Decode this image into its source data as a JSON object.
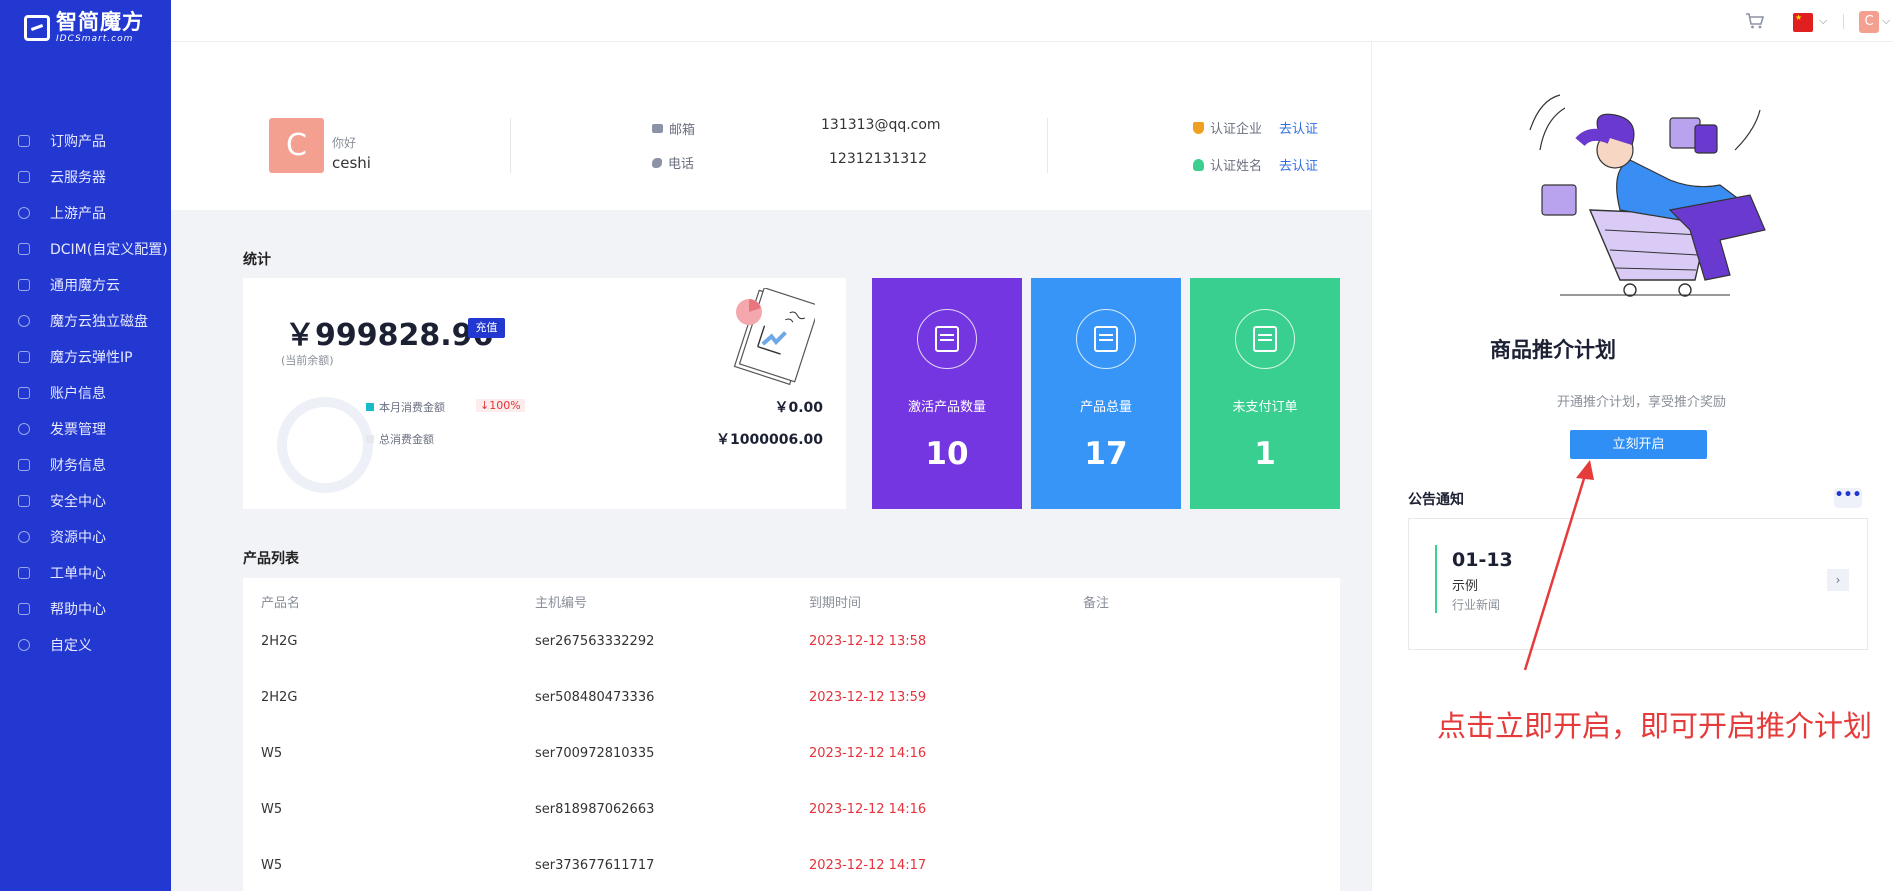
{
  "brand": {
    "name": "智简魔方",
    "sub": "IDCSmart.com"
  },
  "sidebar": {
    "items": [
      {
        "label": "订购产品",
        "icon": "cart-icon"
      },
      {
        "label": "云服务器",
        "icon": "cloud-server-icon"
      },
      {
        "label": "上游产品",
        "icon": "clock-icon"
      },
      {
        "label": "DCIM(自定义配置)",
        "icon": "server-rack-icon"
      },
      {
        "label": "通用魔方云",
        "icon": "cloud-icon"
      },
      {
        "label": "魔方云独立磁盘",
        "icon": "disk-icon"
      },
      {
        "label": "魔方云弹性IP",
        "icon": "ip-icon"
      },
      {
        "label": "账户信息",
        "icon": "user-card-icon"
      },
      {
        "label": "发票管理",
        "icon": "invoice-icon"
      },
      {
        "label": "财务信息",
        "icon": "finance-icon"
      },
      {
        "label": "安全中心",
        "icon": "lock-icon"
      },
      {
        "label": "资源中心",
        "icon": "tag-icon"
      },
      {
        "label": "工单中心",
        "icon": "box-icon"
      },
      {
        "label": "帮助中心",
        "icon": "help-icon"
      },
      {
        "label": "自定义",
        "icon": "info-icon"
      }
    ]
  },
  "topbar": {
    "avatar_letter": "C",
    "language_flag": "china-flag-icon"
  },
  "profile": {
    "avatar_letter": "C",
    "hello": "你好",
    "username": "ceshi",
    "email_label": "邮箱",
    "email_value": "131313@qq.com",
    "phone_label": "电话",
    "phone_value": "12312131312",
    "cert_company_label": "认证企业",
    "cert_company_action": "去认证",
    "cert_name_label": "认证姓名",
    "cert_name_action": "去认证"
  },
  "stats": {
    "title": "统计",
    "balance": "￥999828.96",
    "recharge_label": "充值",
    "balance_sub": "(当前余额)",
    "month_label": "本月消费金额",
    "month_change": "↓100%",
    "month_value": "￥0.00",
    "total_label": "总消费金额",
    "total_value": "￥1000006.00",
    "tiles": [
      {
        "label": "激活产品数量",
        "value": "10",
        "color": "#7436e0"
      },
      {
        "label": "产品总量",
        "value": "17",
        "color": "#3795f7"
      },
      {
        "label": "未支付订单",
        "value": "1",
        "color": "#39cf90"
      }
    ]
  },
  "products": {
    "title": "产品列表",
    "columns": [
      "产品名",
      "主机编号",
      "到期时间",
      "备注"
    ],
    "rows": [
      {
        "name": "2H2G",
        "host": "ser267563332292",
        "expire": "2023-12-12 13:58",
        "note": ""
      },
      {
        "name": "2H2G",
        "host": "ser508480473336",
        "expire": "2023-12-12 13:59",
        "note": ""
      },
      {
        "name": "W5",
        "host": "ser700972810335",
        "expire": "2023-12-12 14:16",
        "note": ""
      },
      {
        "name": "W5",
        "host": "ser818987062663",
        "expire": "2023-12-12 14:16",
        "note": ""
      },
      {
        "name": "W5",
        "host": "ser373677611717",
        "expire": "2023-12-12 14:17",
        "note": ""
      }
    ]
  },
  "promo": {
    "title": "商品推介计划",
    "desc": "开通推介计划，享受推介奖励",
    "button": "立刻开启"
  },
  "notice": {
    "title": "公告通知",
    "more": "•••",
    "date": "01-13",
    "name": "示例",
    "category": "行业新闻",
    "arrow": "›"
  },
  "annotation": {
    "text": "点击立即开启，即可开启推介计划"
  }
}
